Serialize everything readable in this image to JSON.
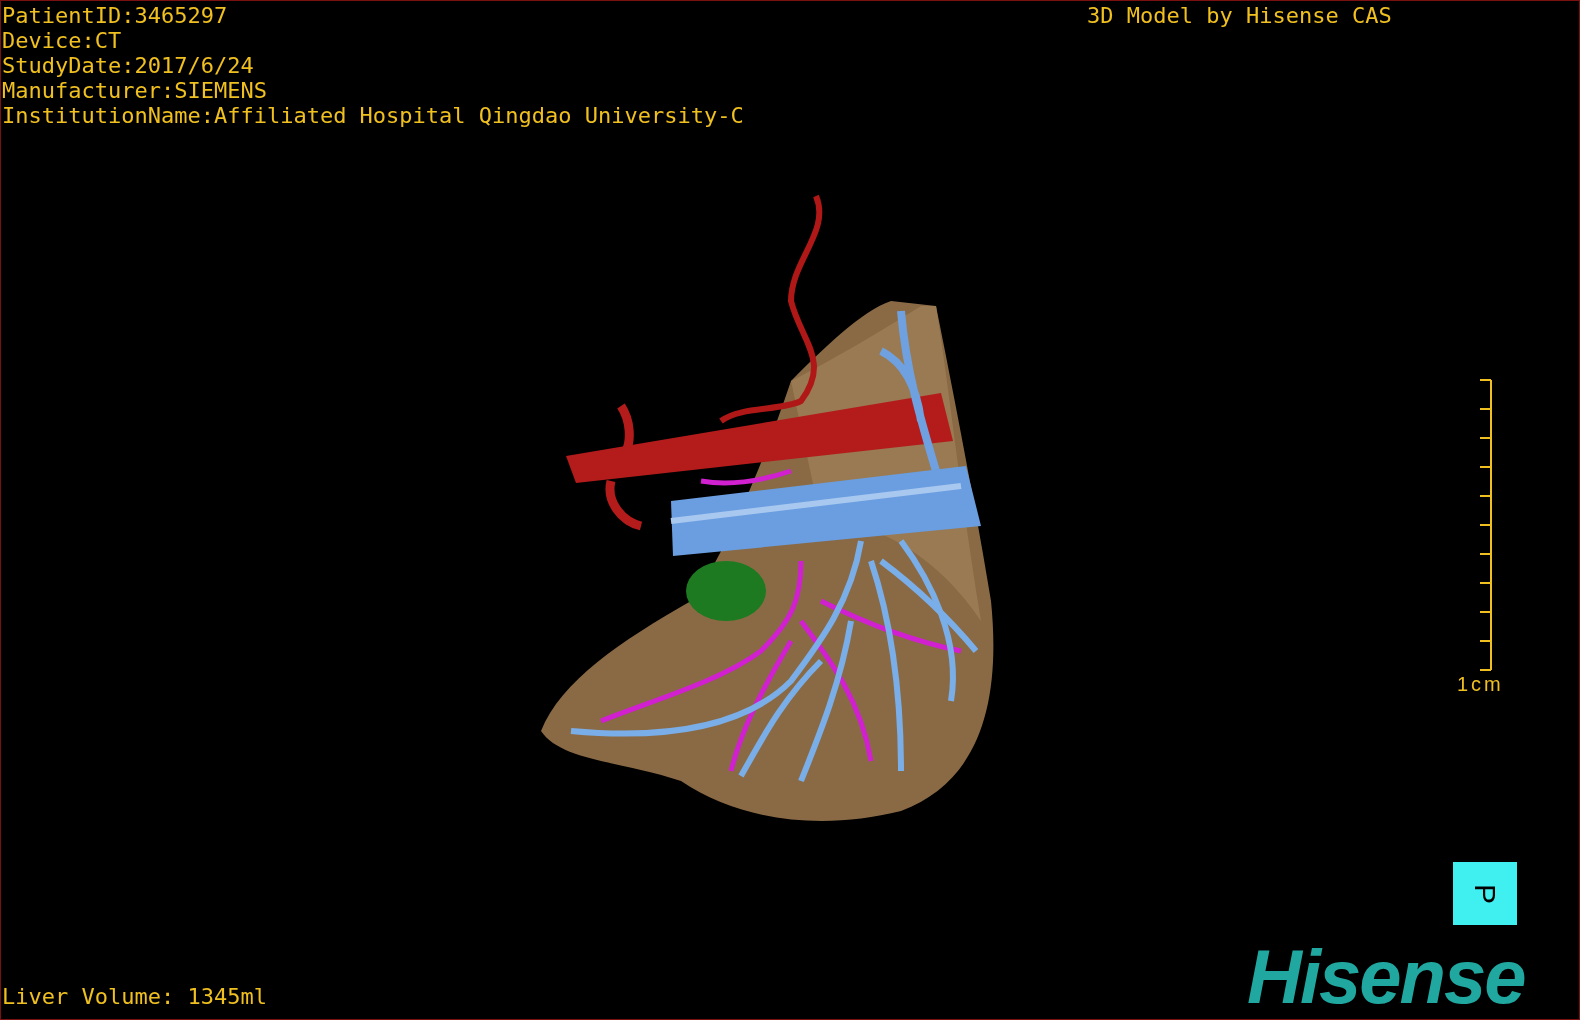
{
  "study_info": [
    "PatientID:3465297",
    "Device:CT",
    "StudyDate:2017/6/24",
    "Manufacturer:SIEMENS",
    "InstitutionName:Affiliated Hospital Qingdao University-C"
  ],
  "model_credit": "3D Model by Hisense CAS",
  "scale_bar": {
    "label": "1cm"
  },
  "orientation_cube": {
    "label": "P"
  },
  "liver_volume": "Liver Volume: 1345ml",
  "logo": "Hisense"
}
